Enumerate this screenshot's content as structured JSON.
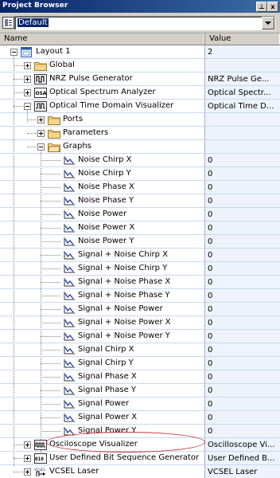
{
  "window": {
    "title": "Project Browser",
    "pin_glyph": "⊥",
    "close_glyph": "x"
  },
  "layout_selector": {
    "value": "Default"
  },
  "columns": {
    "name": "Name",
    "value": "Value"
  },
  "tree": {
    "layout": {
      "label": "Layout 1",
      "value": "2"
    },
    "global": {
      "label": "Global",
      "value": ""
    },
    "nrz": {
      "label": "NRZ Pulse Generator",
      "value": "NRZ Pulse Ge..."
    },
    "osa": {
      "label": "Optical Spectrum Analyzer",
      "value": "Optical Spectr..."
    },
    "otdv": {
      "label": "Optical Time Domain Visualizer",
      "value": "Optical Time D..."
    },
    "ports": {
      "label": "Ports",
      "value": ""
    },
    "parameters": {
      "label": "Parameters",
      "value": ""
    },
    "graphs": {
      "label": "Graphs",
      "value": ""
    },
    "graph_items": [
      {
        "label": "Noise Chirp X",
        "value": "0"
      },
      {
        "label": "Noise Chirp Y",
        "value": "0"
      },
      {
        "label": "Noise Phase X",
        "value": "0"
      },
      {
        "label": "Noise Phase Y",
        "value": "0"
      },
      {
        "label": "Noise Power",
        "value": "0"
      },
      {
        "label": "Noise Power X",
        "value": "0"
      },
      {
        "label": "Noise Power Y",
        "value": "0"
      },
      {
        "label": "Signal + Noise Chirp X",
        "value": "0"
      },
      {
        "label": "Signal + Noise Chirp Y",
        "value": "0"
      },
      {
        "label": "Signal + Noise Phase X",
        "value": "0"
      },
      {
        "label": "Signal + Noise Phase Y",
        "value": "0"
      },
      {
        "label": "Signal + Noise Power",
        "value": "0"
      },
      {
        "label": "Signal + Noise Power X",
        "value": "0"
      },
      {
        "label": "Signal + Noise Power Y",
        "value": "0"
      },
      {
        "label": "Signal Chirp X",
        "value": "0"
      },
      {
        "label": "Signal Chirp Y",
        "value": "0"
      },
      {
        "label": "Signal Phase X",
        "value": "0"
      },
      {
        "label": "Signal Phase Y",
        "value": "0"
      },
      {
        "label": "Signal Power",
        "value": "0"
      },
      {
        "label": "Signal Power X",
        "value": "0"
      },
      {
        "label": "Signal Power Y",
        "value": "0"
      }
    ],
    "osc": {
      "label": "Osciloscope Visualizer",
      "value": "Oscilloscope Vi..."
    },
    "udbsg": {
      "label": "User Defined Bit Sequence Generator",
      "value": "User Defined B..."
    },
    "vcsel": {
      "label": "VCSEL Laser",
      "value": "VCSEL Laser"
    }
  },
  "colors": {
    "title_bar": "#0a246a",
    "value_column": "#eef3fb",
    "highlight_ellipse": "#c0323a"
  }
}
